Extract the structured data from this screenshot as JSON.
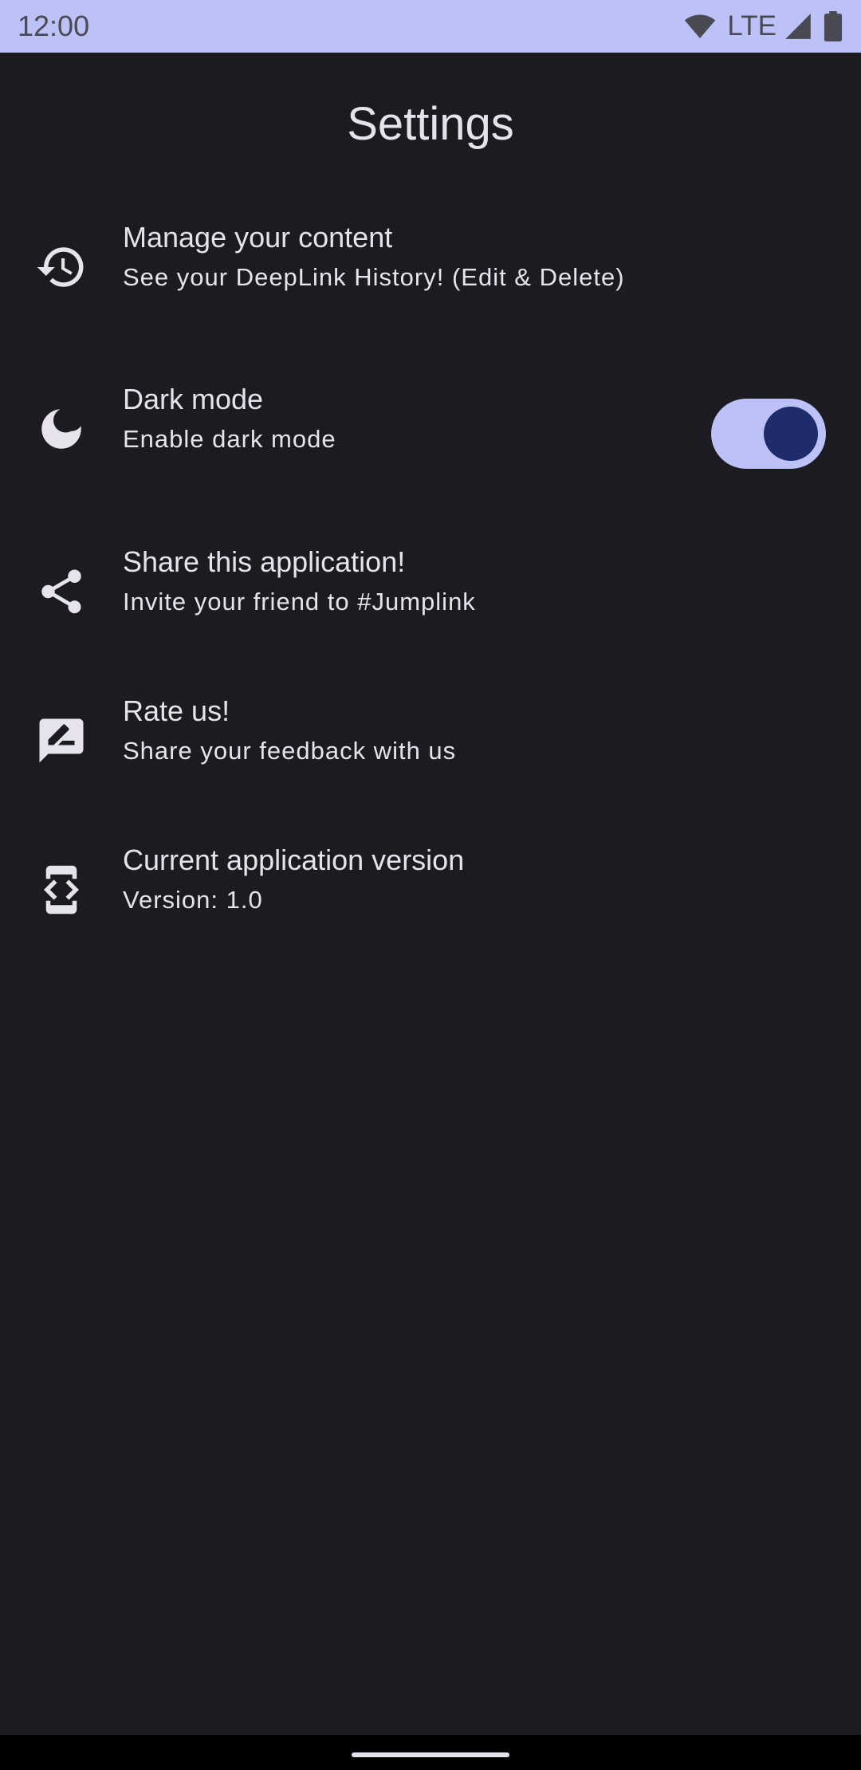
{
  "status_bar": {
    "time": "12:00",
    "network": "LTE",
    "icons": [
      "wifi-icon",
      "cellular-signal-icon",
      "battery-icon"
    ]
  },
  "title": "Settings",
  "settings": [
    {
      "icon": "history-icon",
      "title": "Manage your content",
      "subtitle": "See your DeepLink History! (Edit & Delete)"
    },
    {
      "icon": "moon-icon",
      "title": "Dark mode",
      "subtitle": "Enable dark mode",
      "toggle_on": true
    },
    {
      "icon": "share-icon",
      "title": "Share this application!",
      "subtitle": "Invite your friend to #Jumplink"
    },
    {
      "icon": "rate-review-icon",
      "title": "Rate us!",
      "subtitle": "Share your feedback with us"
    },
    {
      "icon": "developer-mode-icon",
      "title": "Current application version",
      "subtitle": "Version: 1.0"
    }
  ],
  "colors": {
    "background": "#1c1b21",
    "status_bar": "#bcc2f8",
    "text": "#e6e3ec",
    "toggle_track": "#bcc2f8",
    "toggle_thumb": "#1f2b6a"
  }
}
